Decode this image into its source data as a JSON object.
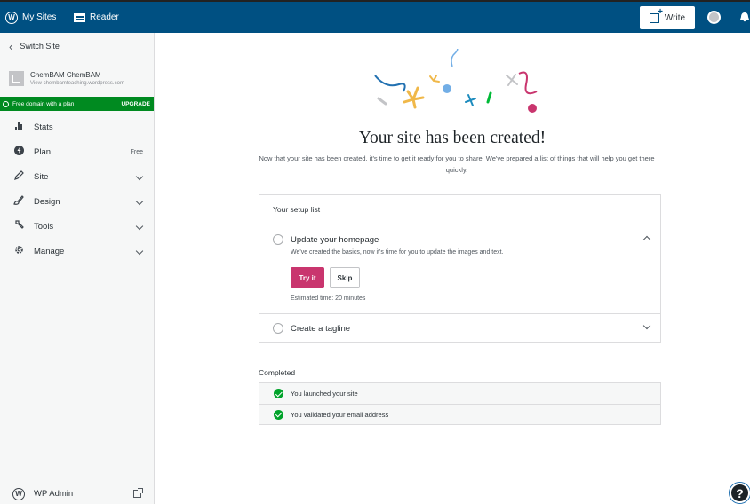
{
  "masterbar": {
    "my_sites_label": "My Sites",
    "reader_label": "Reader",
    "write_label": "Write"
  },
  "sidebar": {
    "switch_site_label": "Switch Site",
    "site_name": "ChemBAM ChemBAM",
    "site_url": "View chembamteaching.wordpress.com",
    "upgrade_text": "Free domain with a plan",
    "upgrade_cta": "UPGRADE",
    "items": [
      {
        "label": "Stats",
        "right": "",
        "icon": "stats-icon"
      },
      {
        "label": "Plan",
        "right": "Free",
        "icon": "plan-icon"
      },
      {
        "label": "Site",
        "right": "",
        "icon": "pencil-icon"
      },
      {
        "label": "Design",
        "right": "",
        "icon": "design-icon"
      },
      {
        "label": "Tools",
        "right": "",
        "icon": "wrench-icon"
      },
      {
        "label": "Manage",
        "right": "",
        "icon": "gear-icon"
      }
    ],
    "wp_admin_label": "WP Admin"
  },
  "main": {
    "title": "Your site has been created!",
    "subtitle": "Now that your site has been created, it's time to get it ready for you to share. We've prepared a list of things that will help you get there quickly.",
    "setup": {
      "header": "Your setup list",
      "open_task": {
        "title": "Update your homepage",
        "description": "We've created the basics, now it's time for you to update the images and text.",
        "primary_button": "Try it",
        "secondary_button": "Skip",
        "estimated_time": "Estimated time: 20 minutes"
      },
      "closed_task": {
        "title": "Create a tagline"
      }
    },
    "completed": {
      "label": "Completed",
      "items": [
        "You launched your site",
        "You validated your email address"
      ]
    }
  },
  "colors": {
    "masterbar": "#005082",
    "upgrade_green": "#008a20",
    "primary_pink": "#c9356e",
    "check_green": "#00a32a"
  }
}
